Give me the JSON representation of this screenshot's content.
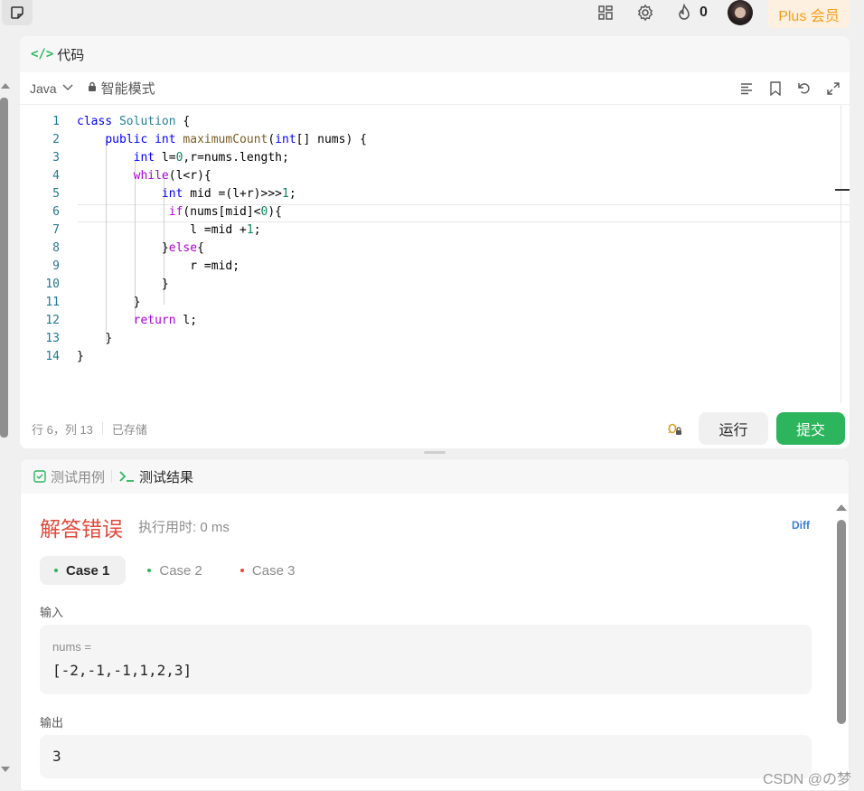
{
  "topbar": {
    "icons": [
      "note-icon",
      "layout-icon",
      "settings-icon",
      "fire-icon"
    ],
    "fire_count": "0",
    "plus_label": "Plus 会员"
  },
  "code_panel": {
    "title": "代码",
    "language": "Java",
    "mode": "智能模式",
    "toolbar_icons": [
      "format-icon",
      "bookmark-icon",
      "reset-icon",
      "expand-icon"
    ],
    "lines": [
      {
        "n": "1"
      },
      {
        "n": "2"
      },
      {
        "n": "3"
      },
      {
        "n": "4"
      },
      {
        "n": "5"
      },
      {
        "n": "6"
      },
      {
        "n": "7"
      },
      {
        "n": "8"
      },
      {
        "n": "9"
      },
      {
        "n": "10"
      },
      {
        "n": "11"
      },
      {
        "n": "12"
      },
      {
        "n": "13"
      },
      {
        "n": "14"
      }
    ],
    "code": {
      "l1_a": "class",
      "l1_b": "Solution",
      "l1_c": " {",
      "l2_a": "public",
      "l2_b": "int",
      "l2_c": "maximumCount",
      "l2_d": "(",
      "l2_e": "int",
      "l2_f": "[] nums) {",
      "l3_a": "int",
      "l3_b": " l=",
      "l3_c": "0",
      "l3_d": ",r=nums.length;",
      "l4_a": "while",
      "l4_b": "(l<r){",
      "l5_a": "int",
      "l5_b": " mid =(l+r)>>>",
      "l5_c": "1",
      "l5_d": ";",
      "l6_a": "if",
      "l6_b": "(nums[mid]<",
      "l6_c": "0",
      "l6_d": "){",
      "l7_a": "l =mid +",
      "l7_b": "1",
      "l7_c": ";",
      "l8_a": "}",
      "l8_b": "else",
      "l8_c": "{",
      "l9_a": "r =mid;",
      "l10_a": "}",
      "l11_a": "}",
      "l12_a": "return",
      "l12_b": " l;",
      "l13_a": "}",
      "l14_a": "}"
    },
    "status_position": "行 6，列 13",
    "status_saved": "已存储",
    "run_label": "运行",
    "submit_label": "提交"
  },
  "result_panel": {
    "tab_testcase": "测试用例",
    "tab_result": "测试结果",
    "verdict": "解答错误",
    "runtime": "执行用时: 0 ms",
    "diff_label": "Diff",
    "cases": [
      {
        "label": "Case 1",
        "status_color": "#2db55d"
      },
      {
        "label": "Case 2",
        "status_color": "#2db55d"
      },
      {
        "label": "Case 3",
        "status_color": "#e14a3b"
      }
    ],
    "input_label": "输入",
    "input_var": "nums =",
    "input_value": "[-2,-1,-1,1,2,3]",
    "output_label": "输出",
    "output_value": "3"
  },
  "watermark": "CSDN @の梦"
}
